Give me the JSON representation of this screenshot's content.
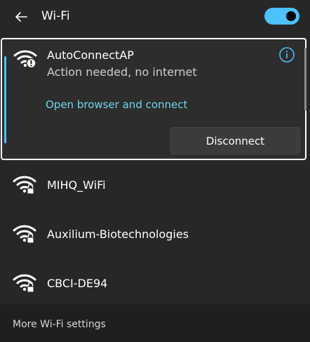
{
  "header": {
    "title": "Wi-Fi",
    "wifi_toggle": "on"
  },
  "connected_network": {
    "name": "AutoConnectAP",
    "status": "Action needed, no internet",
    "link_text": "Open browser and connect",
    "disconnect_label": "Disconnect",
    "icon": "wifi-warning-icon"
  },
  "networks": [
    {
      "name": "MIHQ_WiFi",
      "icon": "wifi-locked-icon"
    },
    {
      "name": "Auxilium-Biotechnologies",
      "icon": "wifi-locked-icon"
    },
    {
      "name": "CBCI-DE94",
      "icon": "wifi-locked-icon"
    }
  ],
  "footer": {
    "more_settings": "More Wi-Fi settings"
  },
  "colors": {
    "accent": "#4cc2ff",
    "link": "#6fd6ee",
    "background": "#272727",
    "footer_background": "#1f1f1f"
  }
}
